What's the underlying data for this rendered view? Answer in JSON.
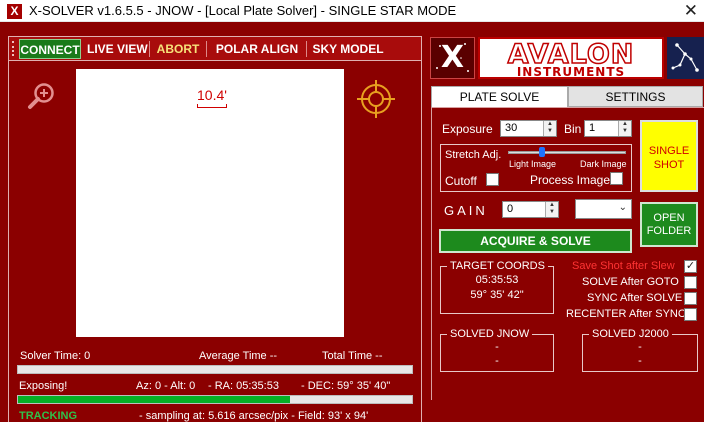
{
  "window": {
    "title": "X-SOLVER v1.6.5.5 - JNOW - [Local Plate Solver]  -  SINGLE STAR MODE",
    "app_icon": "X",
    "close_glyph": "✕"
  },
  "menu": {
    "connect": "CONNECT",
    "live_view": "LIVE VIEW",
    "abort": "ABORT",
    "polar_align": "POLAR ALIGN",
    "sky_model": "SKY MODEL"
  },
  "image": {
    "scale_label": "10.4'"
  },
  "stats": {
    "solver_time": "Solver Time: 0",
    "average_time": "Average Time   --",
    "total_time": "Total Time   --"
  },
  "progress": {
    "solver": 0,
    "exposure": 0.69
  },
  "status": {
    "exposing": "Exposing!",
    "az_alt": "Az: 0   - Alt: 0",
    "ra": "- RA: 05:35:53",
    "dec": "- DEC: 59° 35' 40\"",
    "tracking": "TRACKING",
    "sampling": "- sampling at: 5.616 arcsec/pix - Field:  93' x 94'"
  },
  "logo": {
    "x": "X",
    "avalon": "AVALON",
    "instruments": "INSTRUMENTS"
  },
  "tabs": {
    "plate_solve": "PLATE SOLVE",
    "settings": "SETTINGS"
  },
  "controls": {
    "exposure_label": "Exposure",
    "exposure_value": "30",
    "bin_label": "Bin",
    "bin_value": "1",
    "stretch_label": "Stretch Adj.",
    "light_image": "Light Image",
    "dark_image": "Dark Image",
    "cutoff_label": "Cutoff",
    "process_image_label": "Process Image",
    "gain_label": "GAIN",
    "gain_value": "0",
    "single_shot": "SINGLE SHOT",
    "open_folder": "OPEN FOLDER",
    "acquire_solve": "ACQUIRE & SOLVE"
  },
  "target": {
    "title": "TARGET COORDS",
    "ra": "05:35:53",
    "dec": "59° 35' 42\""
  },
  "options": {
    "save_shot": "Save Shot after Slew",
    "solve_after_goto": "SOLVE After GOTO",
    "sync_after_solve": "SYNC After SOLVE",
    "recenter_after_sync": "RECENTER After SYNC",
    "save_shot_checked": "✓"
  },
  "solved": {
    "jnow_title": "SOLVED JNOW",
    "jnow_ra": "-",
    "jnow_dec": "-",
    "j2000_title": "SOLVED J2000",
    "j2000_ra": "-",
    "j2000_dec": "-"
  },
  "colors": {
    "background": "#8b0000",
    "progress_green": "#06b025",
    "accent_green": "#1d8a1d",
    "shot_yellow": "#ffff00"
  }
}
